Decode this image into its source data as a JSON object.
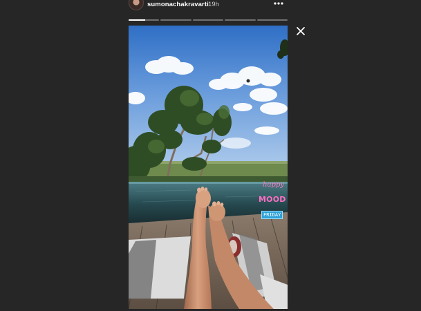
{
  "story": {
    "username": "sumonachakravarti",
    "time_ago": "19h",
    "segment_count": 5,
    "active_segment_index": 0,
    "active_segment_progress": 0.55
  },
  "stickers": {
    "line1": "happy",
    "line2": "MOOD",
    "tag": "FRIDAY"
  },
  "icons": {
    "more": "more-horizontal-icon",
    "close": "close-icon"
  },
  "colors": {
    "background": "#262626",
    "text": "#ffffff",
    "sticker_pink": "#ff6fc4",
    "sticker_blue": "#2ea2d8"
  }
}
